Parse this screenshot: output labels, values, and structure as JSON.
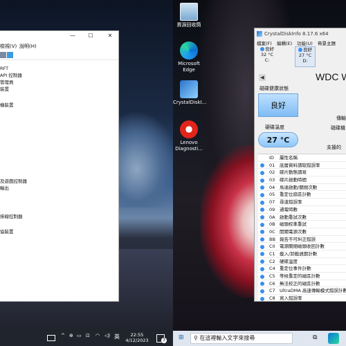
{
  "desktop": {
    "icons": [
      {
        "label": "資源回收筒",
        "icon": "recycle-bin-icon"
      },
      {
        "label": "Microsoft Edge",
        "icon": "edge-icon"
      },
      {
        "label": "CrystalDiskI...",
        "icon": "crystaldiskinfo-icon"
      },
      {
        "label": "Lenovo Diagnosti...",
        "icon": "lenovo-diagnostics-icon"
      }
    ]
  },
  "device_manager": {
    "title_buttons": [
      "—",
      "☐",
      "✕"
    ],
    "menu": [
      "檢視(V)",
      "說明(H)"
    ],
    "tree_items": [
      "RFT",
      "API 控制器",
      "管理員",
      "裝置",
      "機裝置",
      "",
      "",
      "",
      "及遊戲控制器",
      "輸出",
      "",
      "",
      "",
      "",
      "",
      "排線控制器",
      "",
      "",
      "協裝置"
    ]
  },
  "taskbar_left": {
    "ime": "英",
    "time": "22:55",
    "date": "4/12/2023",
    "notification_count": "3"
  },
  "taskbar_right": {
    "search_placeholder": "在這裡輸入文字來搜尋"
  },
  "crystaldiskinfo": {
    "title": "CrystalDiskInfo 8.17.6 x64",
    "menu": [
      "檔案(F)",
      "編輯(E)",
      "功能(U)",
      "佈景主題"
    ],
    "drives": [
      {
        "status": "良好",
        "temp": "32 °C",
        "letter": "C:"
      },
      {
        "status": "良好",
        "temp": "27 °C",
        "letter": "D:"
      }
    ],
    "model": "WDC W",
    "labels": {
      "health_status": "磁碟健康狀態",
      "temperature": "硬碟溫度",
      "transfer": "傳輸",
      "disk_drive": "磁碟機",
      "support": "支援的"
    },
    "health_value": "良好",
    "temperature_value": "27 °C",
    "attributes_header": {
      "id": "ID",
      "name": "屬性名稱"
    },
    "attributes": [
      {
        "id": "01",
        "name": "底層資料讀取錯誤率"
      },
      {
        "id": "02",
        "name": "碟片動態讀寫"
      },
      {
        "id": "03",
        "name": "碟片啟動時間"
      },
      {
        "id": "04",
        "name": "馬達啟動/關閉次數"
      },
      {
        "id": "05",
        "name": "重定位扇區計數"
      },
      {
        "id": "07",
        "name": "尋道錯誤率"
      },
      {
        "id": "09",
        "name": "通電時數"
      },
      {
        "id": "0A",
        "name": "啟動重試次數"
      },
      {
        "id": "0B",
        "name": "磁頭校準重試"
      },
      {
        "id": "0C",
        "name": "開關電源次數"
      },
      {
        "id": "BB",
        "name": "報告不可糾正錯誤"
      },
      {
        "id": "C0",
        "name": "電源關閉磁頭收回計數"
      },
      {
        "id": "C1",
        "name": "載入/卸載週期計數"
      },
      {
        "id": "C2",
        "name": "硬碟溫度"
      },
      {
        "id": "C4",
        "name": "重定位事件計數"
      },
      {
        "id": "C5",
        "name": "等候重定的磁區計數"
      },
      {
        "id": "C6",
        "name": "無法校正的磁區計數"
      },
      {
        "id": "C7",
        "name": "UltraDMA 高速傳輸模式錯誤計數"
      },
      {
        "id": "C8",
        "name": "寫入錯誤率"
      }
    ]
  }
}
